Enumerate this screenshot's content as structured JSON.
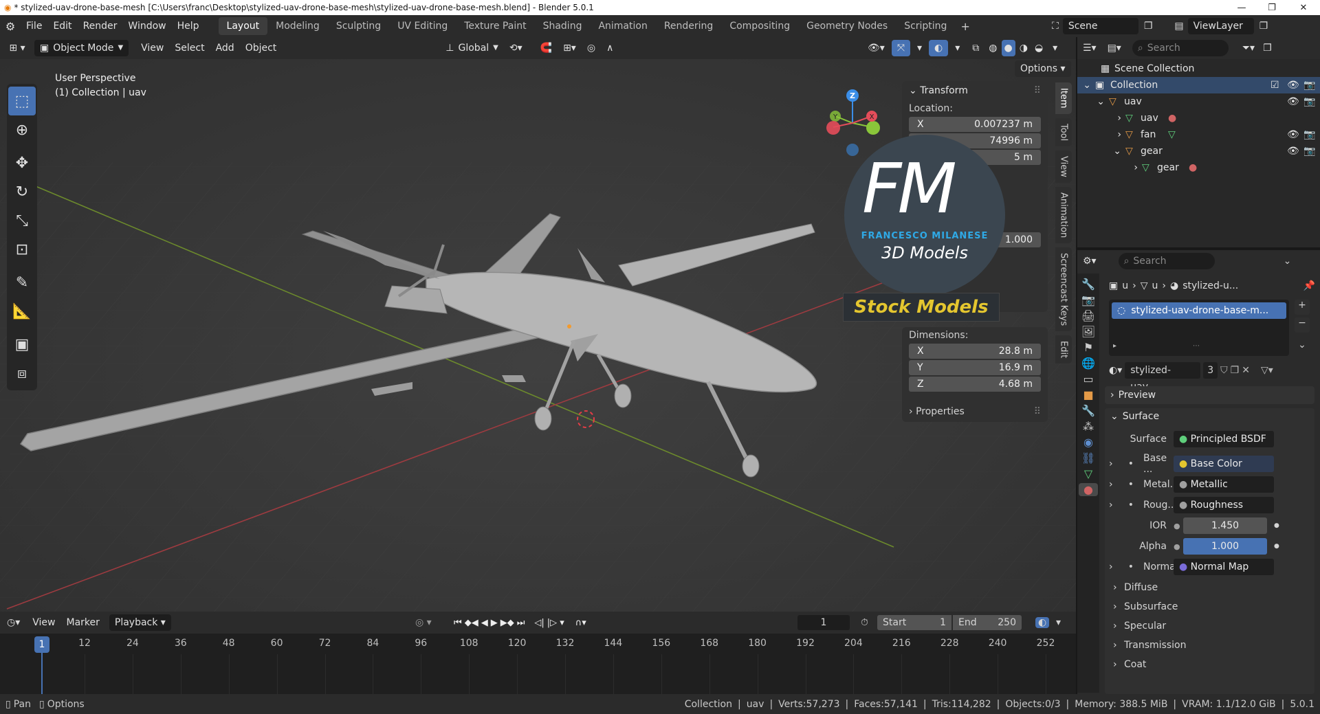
{
  "window": {
    "title": "* stylized-uav-drone-base-mesh [C:\\Users\\franc\\Desktop\\stylized-uav-drone-base-mesh\\stylized-uav-drone-base-mesh.blend] - Blender 5.0.1"
  },
  "menubar": {
    "items": [
      "File",
      "Edit",
      "Render",
      "Window",
      "Help"
    ]
  },
  "workspaces": {
    "tabs": [
      "Layout",
      "Modeling",
      "Sculpting",
      "UV Editing",
      "Texture Paint",
      "Shading",
      "Animation",
      "Rendering",
      "Compositing",
      "Geometry Nodes",
      "Scripting"
    ],
    "active": "Layout"
  },
  "scene": {
    "label": "Scene"
  },
  "viewlayer": {
    "label": "ViewLayer"
  },
  "viewport_header": {
    "mode": "Object Mode",
    "menus": [
      "View",
      "Select",
      "Add",
      "Object"
    ],
    "orientation": "Global",
    "options": "Options"
  },
  "viewport": {
    "perspective": "User Perspective",
    "collection_info": "(1) Collection | uav"
  },
  "gizmo": {
    "z": "Z",
    "y": "Y",
    "x": "X"
  },
  "transform_panel": {
    "title": "Transform",
    "location_label": "Location:",
    "loc_x_label": "X",
    "loc_x": "0.007237 m",
    "loc_y": "74996 m",
    "loc_z": "5 m",
    "scale_z": "1.000",
    "dimensions_label": "Dimensions:",
    "dim_x_label": "X",
    "dim_x": "28.8 m",
    "dim_y_label": "Y",
    "dim_y": "16.9 m",
    "dim_z_label": "Z",
    "dim_z": "4.68 m",
    "properties_label": "Properties"
  },
  "sidebar_tabs": [
    "Item",
    "Tool",
    "View",
    "Animation",
    "Screencast Keys",
    "Edit"
  ],
  "watermark": {
    "logo": "FM",
    "name": "FRANCESCO MILANESE",
    "subtitle": "3D Models",
    "badge": "Stock Models"
  },
  "outliner": {
    "search_placeholder": "Search",
    "rows": [
      {
        "label": "Scene Collection"
      },
      {
        "label": "Collection"
      },
      {
        "label": "uav"
      },
      {
        "label": "uav"
      },
      {
        "label": "fan"
      },
      {
        "label": "gear"
      },
      {
        "label": "gear"
      }
    ]
  },
  "properties": {
    "search_placeholder": "Search",
    "breadcrumb": [
      "u",
      "u",
      "stylized-u..."
    ],
    "material_slot": "stylized-uav-drone-base-m...",
    "material_name": "stylized-uav...",
    "material_users": "3",
    "preview_label": "Preview",
    "surface_panel": "Surface",
    "surface_label": "Surface",
    "surface_value": "Principled BSDF",
    "base_label": "Base ...",
    "base_value": "Base Color",
    "metal_label": "Metal...",
    "metal_value": "Metallic",
    "rough_label": "Roug...",
    "rough_value": "Roughness",
    "ior_label": "IOR",
    "ior_value": "1.450",
    "alpha_label": "Alpha",
    "alpha_value": "1.000",
    "normal_label": "Normal",
    "normal_value": "Normal Map",
    "sections": [
      "Diffuse",
      "Subsurface",
      "Specular",
      "Transmission",
      "Coat"
    ]
  },
  "timeline": {
    "menus": [
      "View",
      "Marker"
    ],
    "playback": "Playback",
    "current_frame": "1",
    "start_label": "Start",
    "start": "1",
    "end_label": "End",
    "end": "250",
    "ticks": [
      "12",
      "24",
      "36",
      "48",
      "60",
      "72",
      "84",
      "96",
      "108",
      "120",
      "132",
      "144",
      "156",
      "168",
      "180",
      "192",
      "204",
      "216",
      "228",
      "240",
      "252"
    ],
    "cursor_frame": "1"
  },
  "statusbar": {
    "pan": "Pan",
    "options": "Options",
    "collection": "Collection",
    "object": "uav",
    "verts": "Verts:57,273",
    "faces": "Faces:57,141",
    "tris": "Tris:114,282",
    "objects": "Objects:0/3",
    "memory": "Memory: 388.5 MiB",
    "vram": "VRAM: 1.1/12.0 GiB",
    "version": "5.0.1"
  },
  "colors": {
    "accent": "#4772b3",
    "header": "#2b2b2b",
    "viewport": "#3a3a3a",
    "gizmo_x": "#e44d5a",
    "gizmo_y": "#8ac63a",
    "gizmo_z": "#3b8ee8",
    "watermark_yellow": "#e4c62f",
    "watermark_blue": "#2fa9e6"
  }
}
